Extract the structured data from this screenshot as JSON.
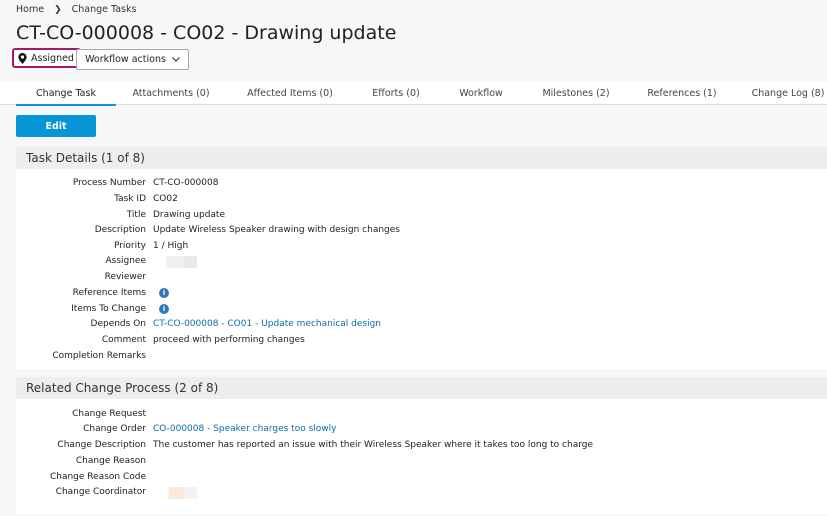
{
  "breadcrumb": {
    "home": "Home",
    "current": "Change Tasks"
  },
  "page_title": "CT-CO-000008 - CO02 - Drawing update",
  "status_badge": {
    "label": "Assigned"
  },
  "workflow_button": {
    "label": "Workflow actions"
  },
  "tabs": [
    {
      "label": "Change Task",
      "active": true
    },
    {
      "label": "Attachments (0)"
    },
    {
      "label": "Affected Items (0)"
    },
    {
      "label": "Efforts (0)"
    },
    {
      "label": "Workflow"
    },
    {
      "label": "Milestones (2)"
    },
    {
      "label": "References (1)"
    },
    {
      "label": "Change Log (8)"
    }
  ],
  "edit_button": {
    "label": "Edit"
  },
  "task_details": {
    "title": "Task Details (1 of 8)",
    "fields": {
      "process_number": {
        "label": "Process Number",
        "value": "CT-CO-000008"
      },
      "task_id": {
        "label": "Task ID",
        "value": "CO02"
      },
      "title": {
        "label": "Title",
        "value": "Drawing update"
      },
      "description": {
        "label": "Description",
        "value": "Update Wireless Speaker drawing with design changes"
      },
      "priority": {
        "label": "Priority",
        "value": "1 / High"
      },
      "assignee": {
        "label": "Assignee",
        "value": ""
      },
      "reviewer": {
        "label": "Reviewer",
        "value": ""
      },
      "reference_items": {
        "label": "Reference Items"
      },
      "items_to_change": {
        "label": "Items To Change"
      },
      "depends_on": {
        "label": "Depends On",
        "value": "CT-CO-000008 - CO01 - Update mechanical design"
      },
      "comment": {
        "label": "Comment",
        "value": "proceed with performing changes"
      },
      "completion_remarks": {
        "label": "Completion Remarks",
        "value": ""
      }
    }
  },
  "related_process": {
    "title": "Related Change Process (2 of 8)",
    "fields": {
      "change_request": {
        "label": "Change Request",
        "value": ""
      },
      "change_order": {
        "label": "Change Order",
        "value": "CO-000008 - Speaker charges too slowly"
      },
      "change_description": {
        "label": "Change Description",
        "value": "The customer has reported an issue with their Wireless Speaker where it takes too long to charge"
      },
      "change_reason": {
        "label": "Change Reason",
        "value": ""
      },
      "change_reason_code": {
        "label": "Change Reason Code",
        "value": ""
      },
      "change_coordinator": {
        "label": "Change Coordinator",
        "value": ""
      }
    }
  },
  "colors": {
    "accent": "#0696d7",
    "badge_border": "#a2196b",
    "link": "#0a6fa8",
    "info_icon": "#2f78b5"
  }
}
